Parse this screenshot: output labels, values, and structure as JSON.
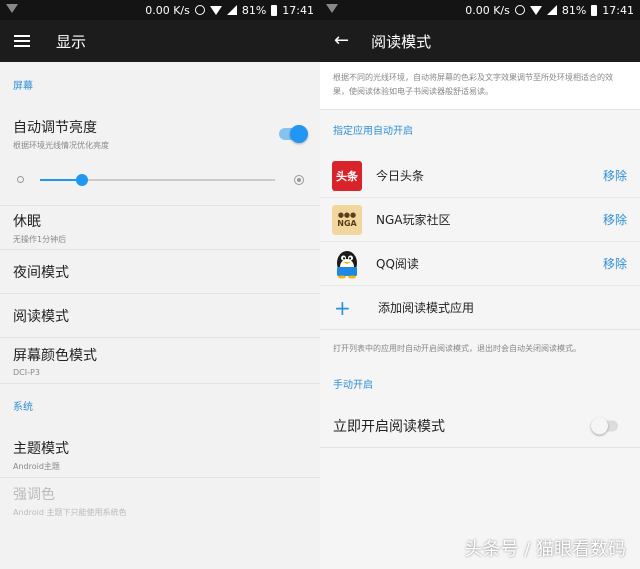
{
  "status_bar": {
    "speed": "0.00 K/s",
    "battery": "81%",
    "time": "17:41"
  },
  "left": {
    "toolbar_title": "显示",
    "section_screen": "屏幕",
    "auto_brightness": {
      "title": "自动调节亮度",
      "subtitle": "根据环境光线情况优化亮度",
      "enabled": true
    },
    "brightness_level": 0.18,
    "sleep": {
      "title": "休眠",
      "subtitle": "无操作1分钟后"
    },
    "night_mode": {
      "title": "夜间模式"
    },
    "reading_mode": {
      "title": "阅读模式"
    },
    "screen_color": {
      "title": "屏幕颜色模式",
      "subtitle": "DCI-P3"
    },
    "section_system": "系统",
    "theme": {
      "title": "主题模式",
      "subtitle": "Android主题"
    },
    "accent": {
      "title": "强调色",
      "subtitle": "Android 主题下只能使用系统色"
    }
  },
  "right": {
    "toolbar_title": "阅读模式",
    "description": "根据不同的光线环境，自动将屏幕的色彩及文字效果调节至所处环境相适合的效果，使阅读体验如电子书阅读器般舒适易读。",
    "section_auto": "指定应用自动开启",
    "apps": [
      {
        "name": "今日头条",
        "icon_text": "头条",
        "action": "移除"
      },
      {
        "name": "NGA玩家社区",
        "icon_text": "NGA",
        "action": "移除"
      },
      {
        "name": "QQ阅读",
        "action": "移除"
      }
    ],
    "add_label": "添加阅读模式应用",
    "auto_note": "打开列表中的应用时自动开启阅读模式，退出时会自动关闭阅读模式。",
    "section_manual": "手动开启",
    "manual": {
      "title": "立即开启阅读模式",
      "enabled": false
    }
  },
  "watermark": "头条号 / 猫眼看数码",
  "colors": {
    "accent": "#2196f3",
    "section": "#2f8fd6",
    "toolbar": "#1c1c1c"
  },
  "icons": [
    "menu-icon",
    "back-icon",
    "wifi-icon",
    "alarm-icon",
    "signal-icon",
    "battery-icon",
    "plus-icon"
  ]
}
